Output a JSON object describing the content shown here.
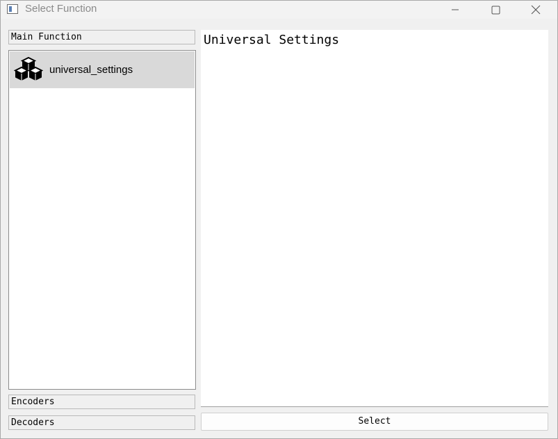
{
  "window": {
    "title": "Select Function",
    "icon": "app-window-icon",
    "controls": [
      "minimize-icon",
      "maximize-icon",
      "close-icon"
    ]
  },
  "sidebar": {
    "sections": [
      {
        "label": "Main Function",
        "expanded": true
      },
      {
        "label": "Encoders",
        "expanded": false
      },
      {
        "label": "Decoders",
        "expanded": false
      }
    ],
    "items": [
      {
        "label": "universal_settings",
        "icon": "cubes-icon",
        "selected": true
      }
    ]
  },
  "detail": {
    "title": "Universal Settings"
  },
  "actions": {
    "select_label": "Select"
  }
}
